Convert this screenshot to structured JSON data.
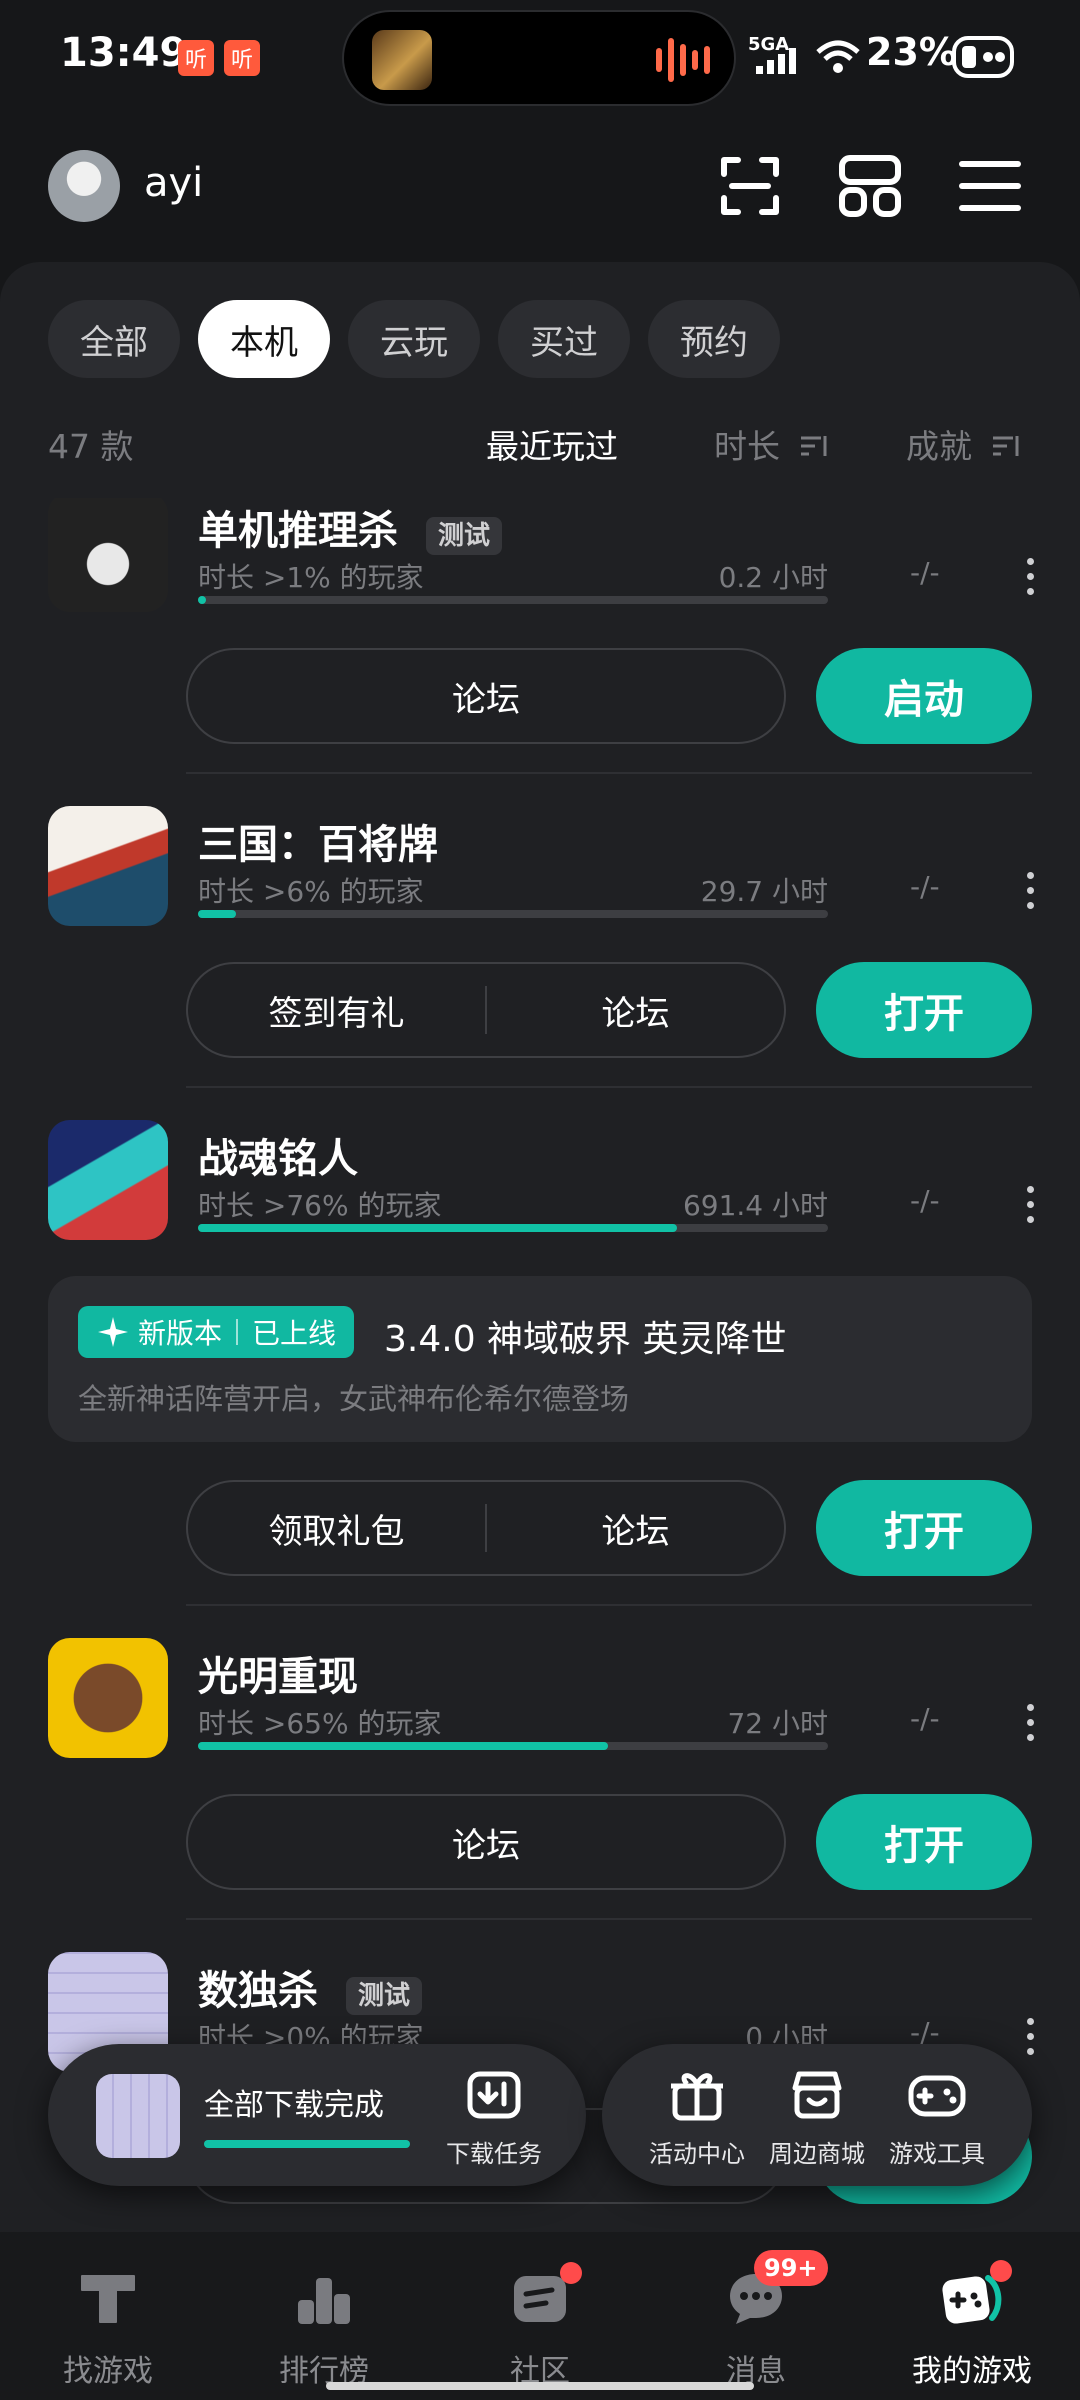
{
  "status_bar": {
    "time": "13:49",
    "badge_1": "听",
    "badge_2": "听",
    "network": "5GA",
    "battery": "23%"
  },
  "header": {
    "username": "ayi"
  },
  "tabs": [
    {
      "label": "全部"
    },
    {
      "label": "本机"
    },
    {
      "label": "云玩"
    },
    {
      "label": "买过"
    },
    {
      "label": "预约"
    }
  ],
  "sort_bar": {
    "count": "47 款",
    "recent": "最近玩过",
    "duration": "时长",
    "achievements": "成就"
  },
  "games": [
    {
      "title": "单机推理杀",
      "tag": "测试",
      "rank_text": "时长 >1% 的玩家",
      "hours": "0.2 小时",
      "progress": 0.01,
      "achievement": "-/-",
      "buttons": [
        "论坛"
      ],
      "primary": "启动"
    },
    {
      "title": "三国：百将牌",
      "rank_text": "时长 >6% 的玩家",
      "hours": "29.7 小时",
      "progress": 0.06,
      "achievement": "-/-",
      "buttons": [
        "签到有礼",
        "论坛"
      ],
      "primary": "打开"
    },
    {
      "title": "战魂铭人",
      "rank_text": "时长 >76% 的玩家",
      "hours": "691.4 小时",
      "progress": 0.76,
      "achievement": "-/-",
      "buttons": [
        "领取礼包",
        "论坛"
      ],
      "primary": "打开"
    },
    {
      "title": "光明重现",
      "rank_text": "时长 >65% 的玩家",
      "hours": "72 小时",
      "progress": 0.65,
      "achievement": "-/-",
      "buttons": [
        "论坛"
      ],
      "primary": "打开"
    },
    {
      "title": "数独杀",
      "tag": "测试",
      "rank_text": "时长 >0% 的玩家",
      "hours": "0 小时",
      "progress": 0,
      "achievement": "-/-"
    }
  ],
  "update_card": {
    "tag_new": "新版本",
    "tag_online": "已上线",
    "title": "3.4.0 神域破界 英灵降世",
    "desc": "全新神话阵营开启，女武神布伦希尔德登场"
  },
  "download_bar": {
    "label": "全部下载完成",
    "progress": 1.0,
    "task_label": "下载任务"
  },
  "quick_tools": [
    {
      "label": "活动中心",
      "icon": "gift-icon"
    },
    {
      "label": "周边商城",
      "icon": "shop-icon"
    },
    {
      "label": "游戏工具",
      "icon": "gamepad-icon"
    }
  ],
  "bottom_nav": [
    {
      "label": "找游戏",
      "icon": "find-game-icon"
    },
    {
      "label": "排行榜",
      "icon": "ranking-icon"
    },
    {
      "label": "社区",
      "icon": "community-icon"
    },
    {
      "label": "消息",
      "icon": "message-icon",
      "badge": "99+"
    },
    {
      "label": "我的游戏",
      "icon": "my-games-icon"
    }
  ],
  "colors": {
    "accent": "#11b8a1",
    "background": "#161719",
    "panel": "#1f2023",
    "badge_red": "#ff4b4b"
  }
}
